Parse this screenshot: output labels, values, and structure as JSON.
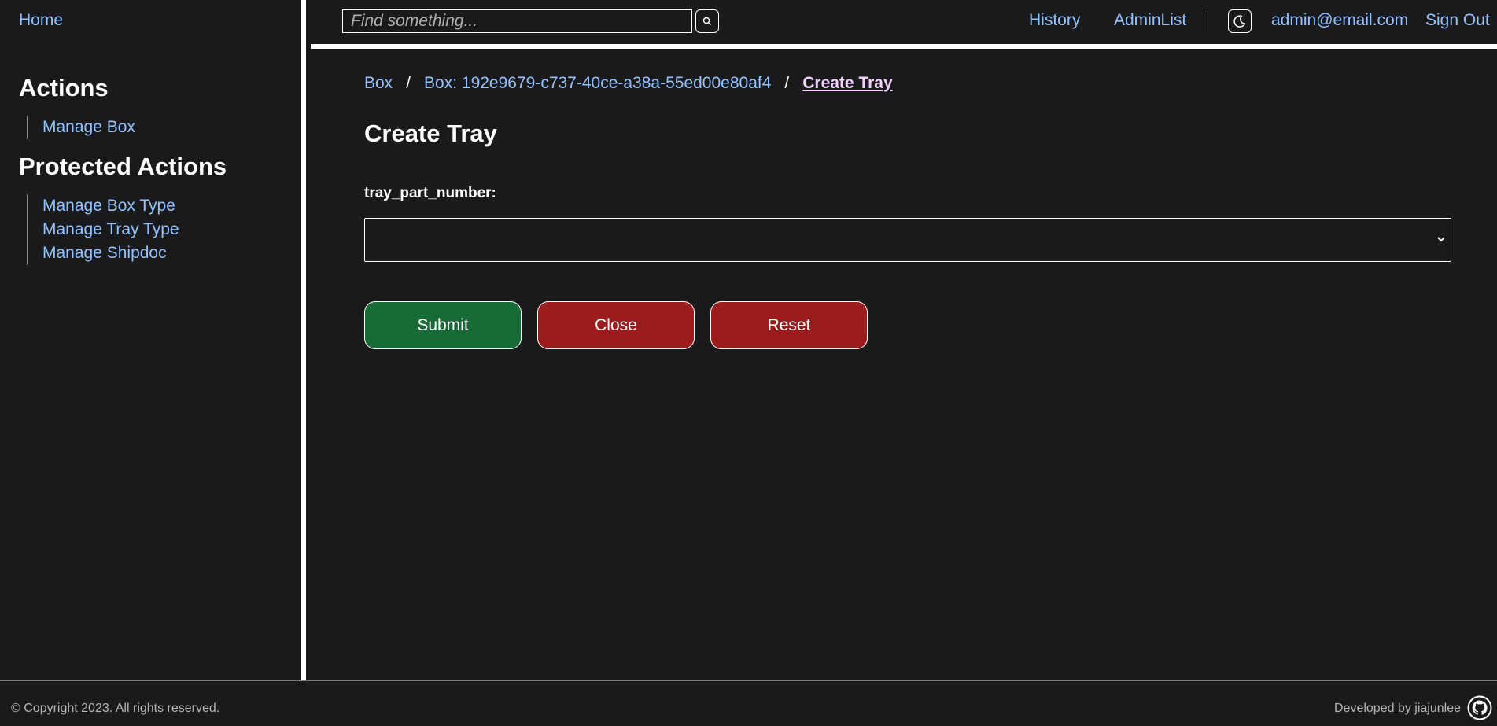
{
  "sidebar": {
    "home": "Home",
    "actions_heading": "Actions",
    "actions": [
      "Manage Box"
    ],
    "protected_heading": "Protected Actions",
    "protected": [
      "Manage Box Type",
      "Manage Tray Type",
      "Manage Shipdoc"
    ]
  },
  "topbar": {
    "search_placeholder": "Find something...",
    "history": "History",
    "adminlist": "AdminList",
    "user": "admin@email.com",
    "signout": "Sign Out"
  },
  "breadcrumb": {
    "items": [
      "Box",
      "Box: 192e9679-c737-40ce-a38a-55ed00e80af4"
    ],
    "separator": "/",
    "current": "Create Tray"
  },
  "form": {
    "title": "Create Tray",
    "field_label": "tray_part_number:",
    "select_value": "",
    "submit": "Submit",
    "close": "Close",
    "reset": "Reset"
  },
  "footer": {
    "copyright": "© Copyright 2023. All rights reserved.",
    "developer": "Developed by jiajunlee"
  },
  "icons": {
    "search": "search-icon",
    "theme": "moon-icon",
    "select": "chevron-down-icon",
    "github": "github-icon"
  },
  "colors": {
    "background": "#1a1a1d",
    "link": "#93c3ff",
    "submit": "#176b37",
    "danger": "#9b1c1c",
    "current_crumb": "#f2d0ff"
  }
}
